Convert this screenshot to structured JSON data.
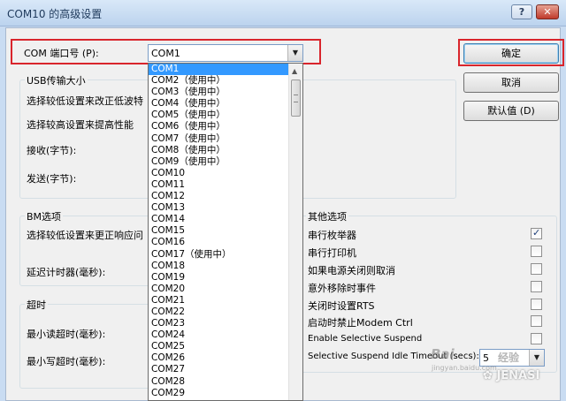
{
  "window": {
    "title": "COM10 的高级设置",
    "help_glyph": "?",
    "close_glyph": "✕"
  },
  "port": {
    "label": "COM 端口号 (P):",
    "selected": "COM1"
  },
  "buttons": {
    "ok": "确定",
    "cancel": "取消",
    "defaults": "默认值 (D)"
  },
  "usb": {
    "group_title": "USB传输大小",
    "line1": "选择较低设置来改正低波特",
    "line2": "选择较高设置来提高性能",
    "receive": "接收(字节):",
    "send": "发送(字节):"
  },
  "bm": {
    "group_title": "BM选项",
    "line1": "选择较低设置来更正响应问",
    "latency": "延迟计时器(毫秒):"
  },
  "timeouts": {
    "group_title": "超时",
    "min_read": "最小读超时(毫秒):",
    "min_write": "最小写超时(毫秒):"
  },
  "misc": {
    "group_title": "其他选项",
    "options": [
      {
        "label": "串行枚举器",
        "checked": true
      },
      {
        "label": "串行打印机",
        "checked": false
      },
      {
        "label": "如果电源关闭则取消",
        "checked": false
      },
      {
        "label": "意外移除时事件",
        "checked": false
      },
      {
        "label": "关闭时设置RTS",
        "checked": false
      },
      {
        "label": "启动时禁止Modem Ctrl",
        "checked": false
      },
      {
        "label": "Enable Selective Suspend",
        "checked": false
      },
      {
        "label": "Selective Suspend Idle Timeout (secs):",
        "checked": false
      }
    ],
    "idle_timeout_value": "5"
  },
  "port_list": [
    "COM1",
    "COM2（使用中）",
    "COM3（使用中）",
    "COM4（使用中）",
    "COM5（使用中）",
    "COM6（使用中）",
    "COM7（使用中）",
    "COM8（使用中）",
    "COM9（使用中）",
    "COM10",
    "COM11",
    "COM12",
    "COM13",
    "COM14",
    "COM15",
    "COM16",
    "COM17（使用中）",
    "COM18",
    "COM19",
    "COM20",
    "COM21",
    "COM22",
    "COM23",
    "COM24",
    "COM25",
    "COM26",
    "COM27",
    "COM28",
    "COM29"
  ],
  "watermark": {
    "baidu": "Bai",
    "jingyan": "经验",
    "jingyan_url": "jingyan.baidu.com",
    "brand": "JENASI"
  }
}
